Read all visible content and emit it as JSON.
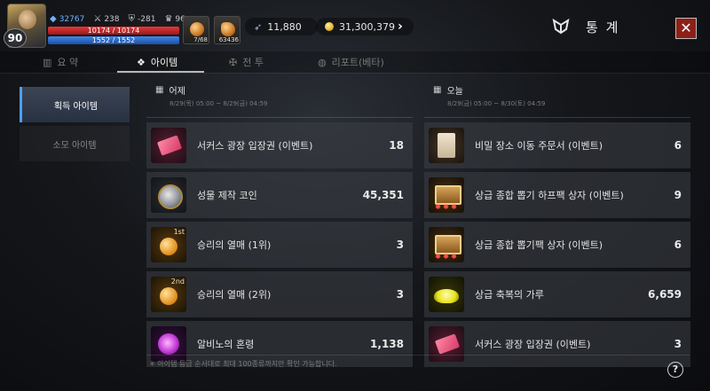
{
  "player": {
    "level": "90",
    "combat_power": "32767",
    "stat_atk": "238",
    "stat_def": "-281",
    "stat_trophy": "96",
    "hp_text": "10174 / 10174",
    "hp_fraction": 1.0,
    "mp_text": "1552 / 1552",
    "mp_fraction": 1.0,
    "quick_slot_1_count": "7/68",
    "quick_slot_2_count": "63436"
  },
  "currency": {
    "crystal": "11,880",
    "gold": "31,300,379"
  },
  "window": {
    "title": "통 계",
    "close_label": "✕"
  },
  "tabs": [
    {
      "label": "요 약",
      "icon": "summary-icon",
      "active": false
    },
    {
      "label": "아이템",
      "icon": "item-icon",
      "active": true
    },
    {
      "label": "전 투",
      "icon": "battle-icon",
      "active": false
    },
    {
      "label": "리포트(베타)",
      "icon": "report-icon",
      "active": false
    }
  ],
  "side_menu": [
    {
      "label": "획득 아이템",
      "active": true
    },
    {
      "label": "소모 아이템",
      "active": false
    }
  ],
  "yesterday": {
    "title": "어제",
    "range": "8/29(목) 05:00 ~ 8/29(금) 04:59",
    "items": [
      {
        "name": "서커스 광장 입장권 (이벤트)",
        "qty": "18",
        "icon": "ticket-icon"
      },
      {
        "name": "성물 제작 코인",
        "qty": "45,351",
        "icon": "coin-icon"
      },
      {
        "name": "승리의 열매 (1위)",
        "qty": "3",
        "icon": "fruit-icon",
        "rank": "1st"
      },
      {
        "name": "승리의 열매 (2위)",
        "qty": "3",
        "icon": "fruit-icon",
        "rank": "2nd"
      },
      {
        "name": "알비노의 혼령",
        "qty": "1,138",
        "icon": "soul-icon"
      }
    ]
  },
  "today": {
    "title": "오늘",
    "range": "8/29(금) 05:00 ~ 8/30(토) 04:59",
    "items": [
      {
        "name": "비밀 장소 이동 주문서 (이벤트)",
        "qty": "6",
        "icon": "scroll-icon"
      },
      {
        "name": "상급 종합 뽑기 하프팩 상자 (이벤트)",
        "qty": "9",
        "icon": "chest-icon"
      },
      {
        "name": "상급 종합 뽑기팩 상자 (이벤트)",
        "qty": "6",
        "icon": "chest-icon"
      },
      {
        "name": "상급 축복의 가루",
        "qty": "6,659",
        "icon": "powder-icon"
      },
      {
        "name": "서커스 광장 입장권 (이벤트)",
        "qty": "3",
        "icon": "ticket-icon"
      }
    ]
  },
  "footer_note": "✳ 아이템 등급 순서대로 최대 100종류까지만 확인 가능합니다.",
  "help_label": "?"
}
